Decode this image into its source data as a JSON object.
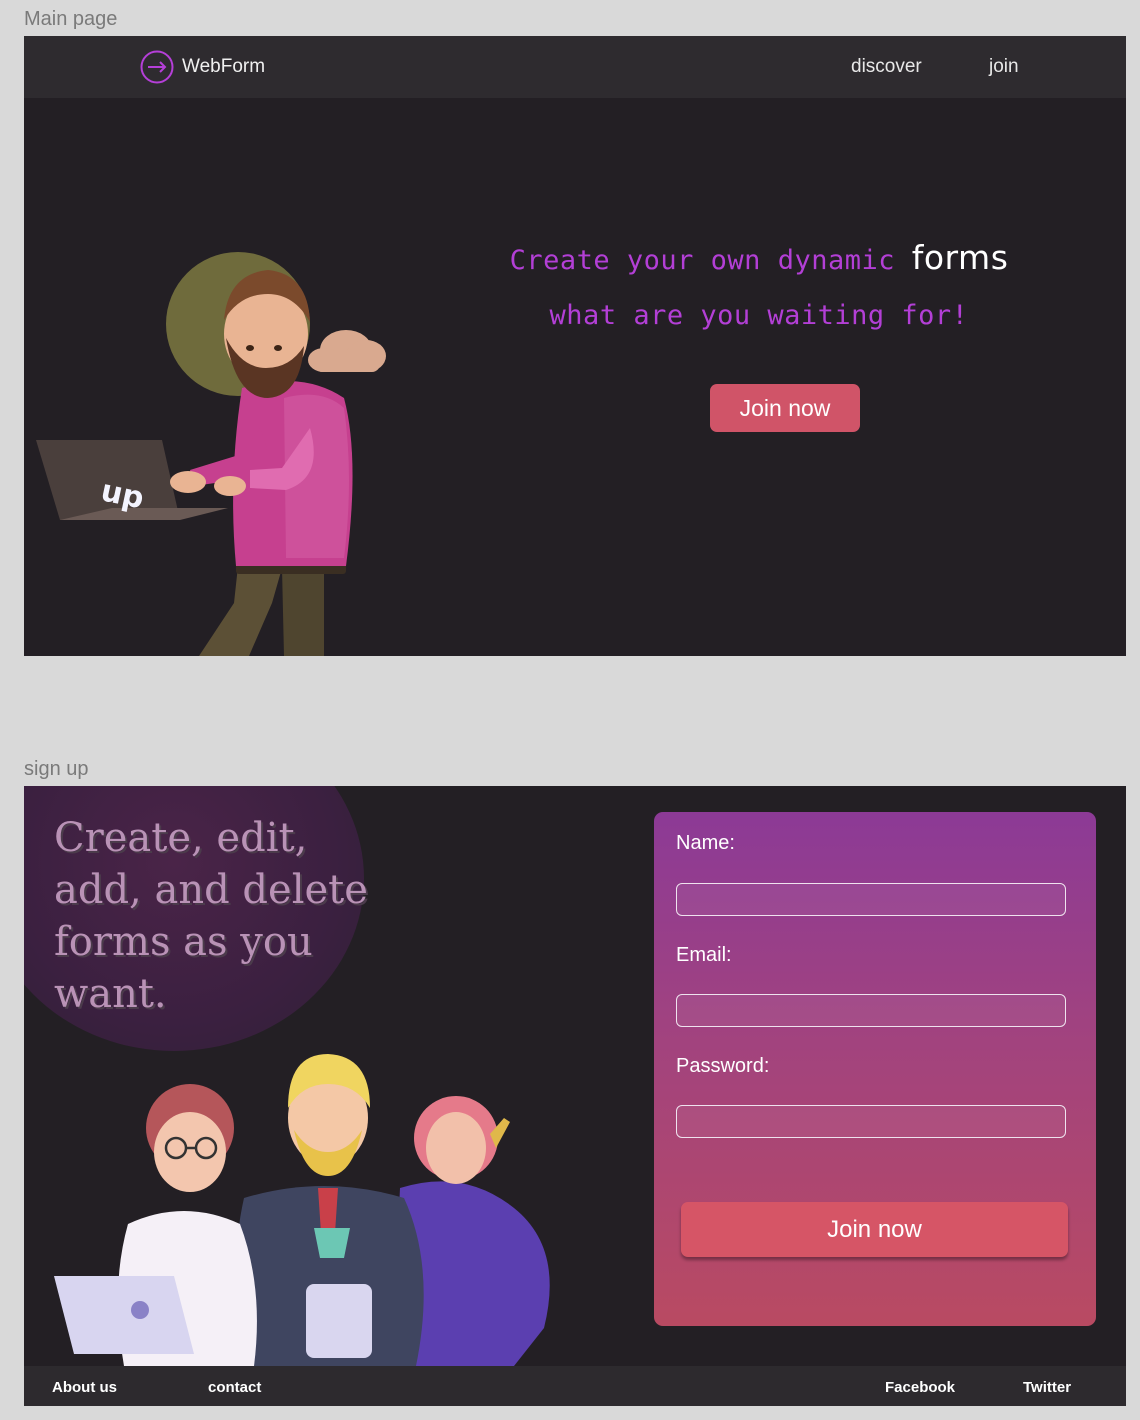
{
  "frames": {
    "main_label": "Main page",
    "signup_label": "sign up"
  },
  "main": {
    "logo_text": "WebForm",
    "nav": {
      "discover": "discover",
      "join": "join"
    },
    "hero": {
      "line1": "Create your own dynamic",
      "line1_accent": "forms",
      "line2": "what are you waiting for!",
      "button": "Join now"
    },
    "laptop_sticker": "up"
  },
  "signup": {
    "promo": "Create, edit, add, and delete forms as you want.",
    "form": {
      "name_label": "Name:",
      "email_label": "Email:",
      "password_label": "Password:",
      "submit": "Join now"
    },
    "footer": {
      "about": "About us",
      "contact": "contact",
      "facebook": "Facebook",
      "twitter": "Twitter"
    }
  },
  "colors": {
    "background": "#231f24",
    "navbar": "#2e2b2f",
    "hero_purple": "#b33fd6",
    "button_pink": "#d05468",
    "card_top": "#8c3a96",
    "card_bottom": "#b94a62"
  }
}
